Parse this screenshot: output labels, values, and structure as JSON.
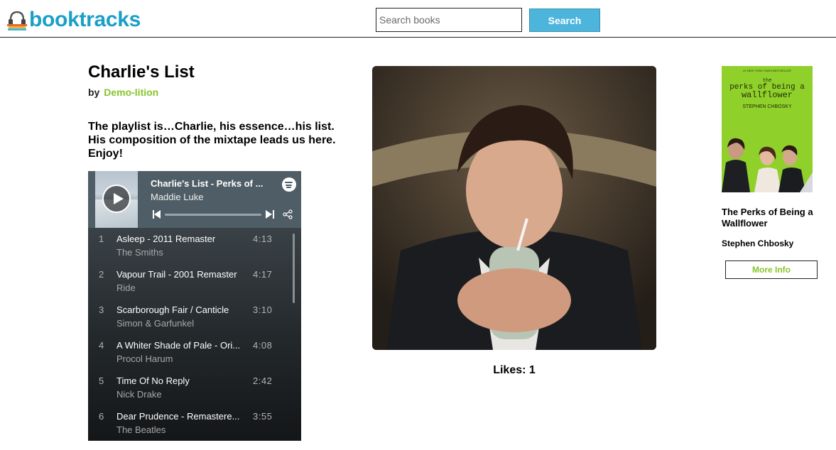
{
  "header": {
    "logo_text": "booktracks",
    "search_placeholder": "Search books",
    "search_button": "Search"
  },
  "playlist": {
    "title": "Charlie's List",
    "by_label": "by",
    "author": "Demo-lition",
    "description": "The playlist is…Charlie, his essence…his list. His composition of the mixtape leads us here. Enjoy!"
  },
  "player": {
    "now_playing_title": "Charlie's List - Perks of ...",
    "now_playing_artist": "Maddie Luke",
    "tracks": [
      {
        "num": "1",
        "name": "Asleep - 2011 Remaster",
        "duration": "4:13",
        "artist": "The Smiths"
      },
      {
        "num": "2",
        "name": "Vapour Trail - 2001 Remaster",
        "duration": "4:17",
        "artist": "Ride"
      },
      {
        "num": "3",
        "name": "Scarborough Fair / Canticle",
        "duration": "3:10",
        "artist": "Simon & Garfunkel"
      },
      {
        "num": "4",
        "name": "A Whiter Shade of Pale - Ori...",
        "duration": "4:08",
        "artist": "Procol Harum"
      },
      {
        "num": "5",
        "name": "Time Of No Reply",
        "duration": "2:42",
        "artist": "Nick Drake"
      },
      {
        "num": "6",
        "name": "Dear Prudence - Remastere...",
        "duration": "3:55",
        "artist": "The Beatles"
      }
    ]
  },
  "likes": {
    "text": "Likes: 1"
  },
  "book": {
    "cover_tagline": "#1 NEW YORK TIMES BESTSELLER",
    "cover_title_line1": "the",
    "cover_title_line2": "perks of being a",
    "cover_title_line3": "wallflower",
    "cover_author": "STEPHEN CHBOSKY",
    "title": "The Perks of Being a Wallflower",
    "author": "Stephen Chbosky",
    "more_info_label": "More Info"
  },
  "colors": {
    "brand": "#1aa0c7",
    "accent_green": "#86c52a",
    "search_button": "#4db5dc"
  }
}
